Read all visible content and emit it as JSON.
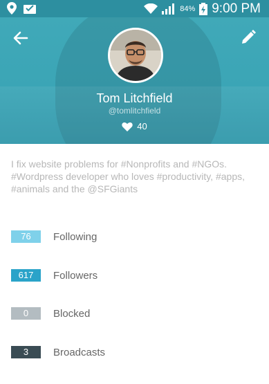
{
  "status_bar": {
    "battery_percent": "84%",
    "time": "9:00 PM",
    "icons": [
      "location-icon",
      "notification-icon",
      "wifi-icon",
      "signal-icon",
      "battery-icon"
    ]
  },
  "header": {
    "back_icon": "arrow-left-icon",
    "edit_icon": "pencil-icon",
    "name": "Tom Litchfield",
    "handle": "@tomlitchfield",
    "likes": "40"
  },
  "bio": "I fix website problems for #Nonprofits and #NGOs. #Wordpress developer who loves #productivity, #apps, #animals and the @SFGiants",
  "stats": [
    {
      "count": "76",
      "label": "Following",
      "color": "#7fd1ea"
    },
    {
      "count": "617",
      "label": "Followers",
      "color": "#2aa3c9"
    },
    {
      "count": "0",
      "label": "Blocked",
      "color": "#b3bcc1"
    },
    {
      "count": "3",
      "label": "Broadcasts",
      "color": "#3a4c54"
    }
  ]
}
